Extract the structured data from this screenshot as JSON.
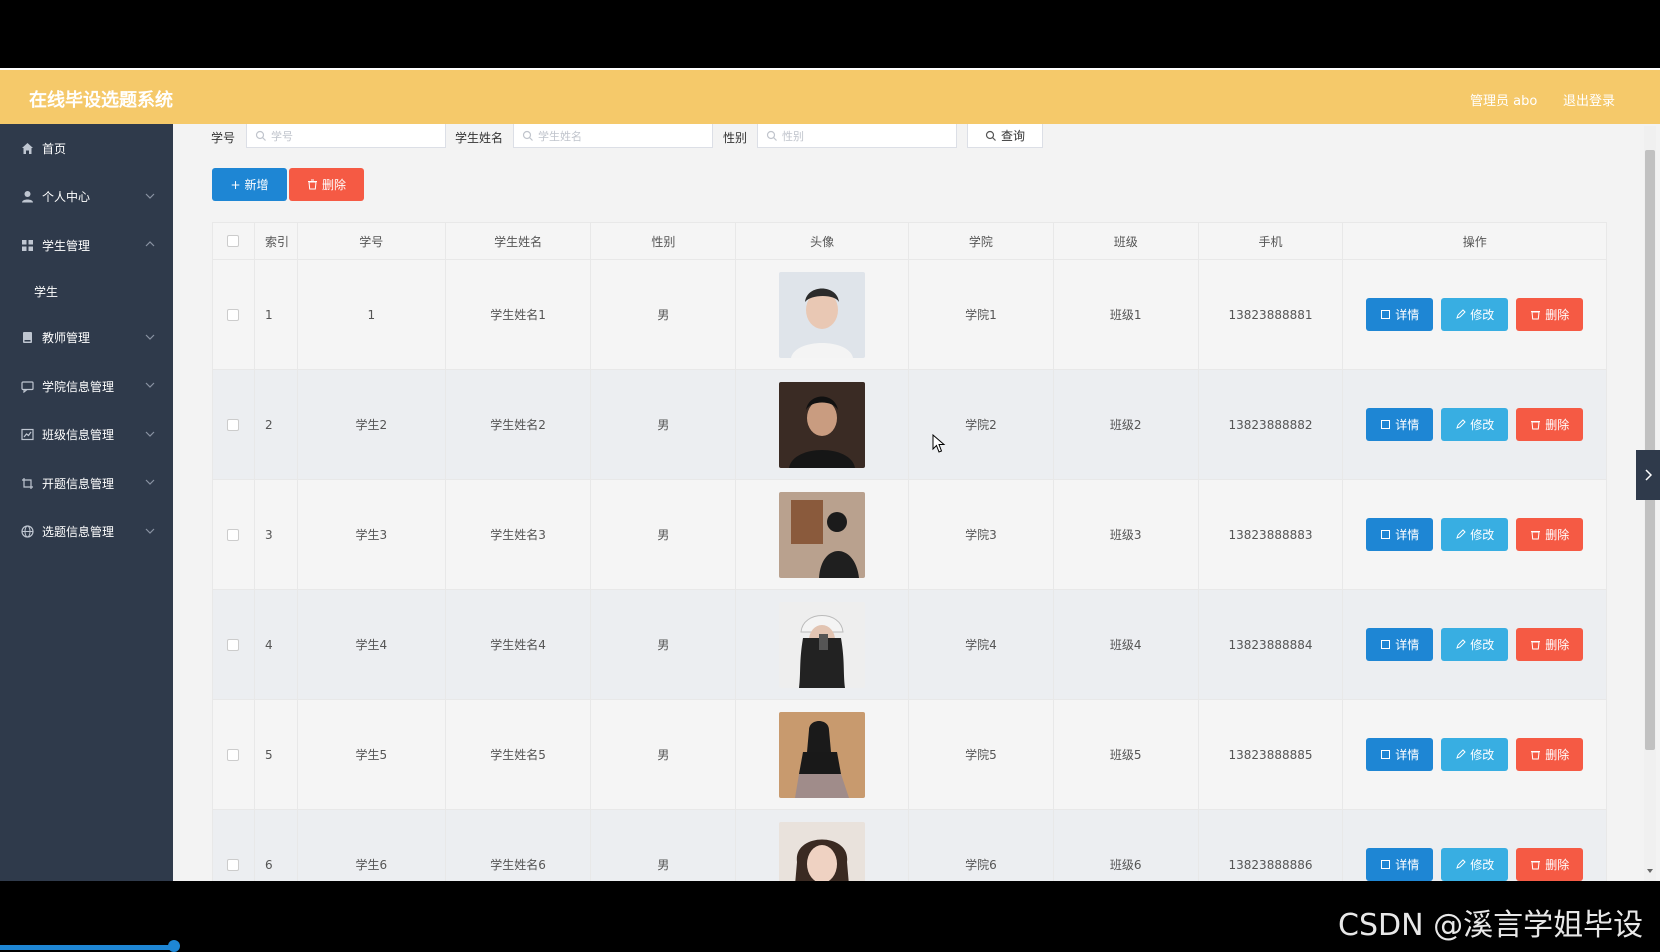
{
  "header": {
    "title": "在线毕设选题系统",
    "admin": "管理员 abo",
    "logout": "退出登录"
  },
  "sidebar": {
    "items": [
      {
        "label": "首页",
        "icon": "home-icon"
      },
      {
        "label": "个人中心",
        "icon": "user-icon",
        "chevron": "down"
      },
      {
        "label": "学生管理",
        "icon": "grid-icon",
        "chevron": "up"
      },
      {
        "label": "学生",
        "sub": true
      },
      {
        "label": "教师管理",
        "icon": "book-icon",
        "chevron": "down"
      },
      {
        "label": "学院信息管理",
        "icon": "chat-icon",
        "chevron": "down"
      },
      {
        "label": "班级信息管理",
        "icon": "chart-icon",
        "chevron": "down"
      },
      {
        "label": "开题信息管理",
        "icon": "crop-icon",
        "chevron": "down"
      },
      {
        "label": "选题信息管理",
        "icon": "globe-icon",
        "chevron": "down"
      }
    ]
  },
  "search": {
    "student_no_label": "学号",
    "student_no_placeholder": "学号",
    "name_label": "学生姓名",
    "name_placeholder": "学生姓名",
    "sex_label": "性别",
    "sex_placeholder": "性别",
    "query_label": "查询"
  },
  "toolbar": {
    "add_label": "新增",
    "delete_label": "删除"
  },
  "table": {
    "headers": [
      "索引",
      "学号",
      "学生姓名",
      "性别",
      "头像",
      "学院",
      "班级",
      "手机",
      "操作"
    ],
    "rows": [
      {
        "idx": "1",
        "no": "1",
        "name": "学生姓名1",
        "sex": "男",
        "college": "学院1",
        "class": "班级1",
        "phone": "13823888881"
      },
      {
        "idx": "2",
        "no": "学生2",
        "name": "学生姓名2",
        "sex": "男",
        "college": "学院2",
        "class": "班级2",
        "phone": "13823888882"
      },
      {
        "idx": "3",
        "no": "学生3",
        "name": "学生姓名3",
        "sex": "男",
        "college": "学院3",
        "class": "班级3",
        "phone": "13823888883"
      },
      {
        "idx": "4",
        "no": "学生4",
        "name": "学生姓名4",
        "sex": "男",
        "college": "学院4",
        "class": "班级4",
        "phone": "13823888884"
      },
      {
        "idx": "5",
        "no": "学生5",
        "name": "学生姓名5",
        "sex": "男",
        "college": "学院5",
        "class": "班级5",
        "phone": "13823888885"
      },
      {
        "idx": "6",
        "no": "学生6",
        "name": "学生姓名6",
        "sex": "男",
        "college": "学院6",
        "class": "班级6",
        "phone": "13823888886"
      }
    ],
    "actions": {
      "detail": "详情",
      "edit": "修改",
      "delete": "删除"
    }
  },
  "watermark": "CSDN @溪言学姐毕设",
  "colors": {
    "header": "#f5c96a",
    "sidebar": "#2f3a4b",
    "primary": "#1e86d4",
    "info": "#38aee2",
    "danger": "#f55a44"
  }
}
